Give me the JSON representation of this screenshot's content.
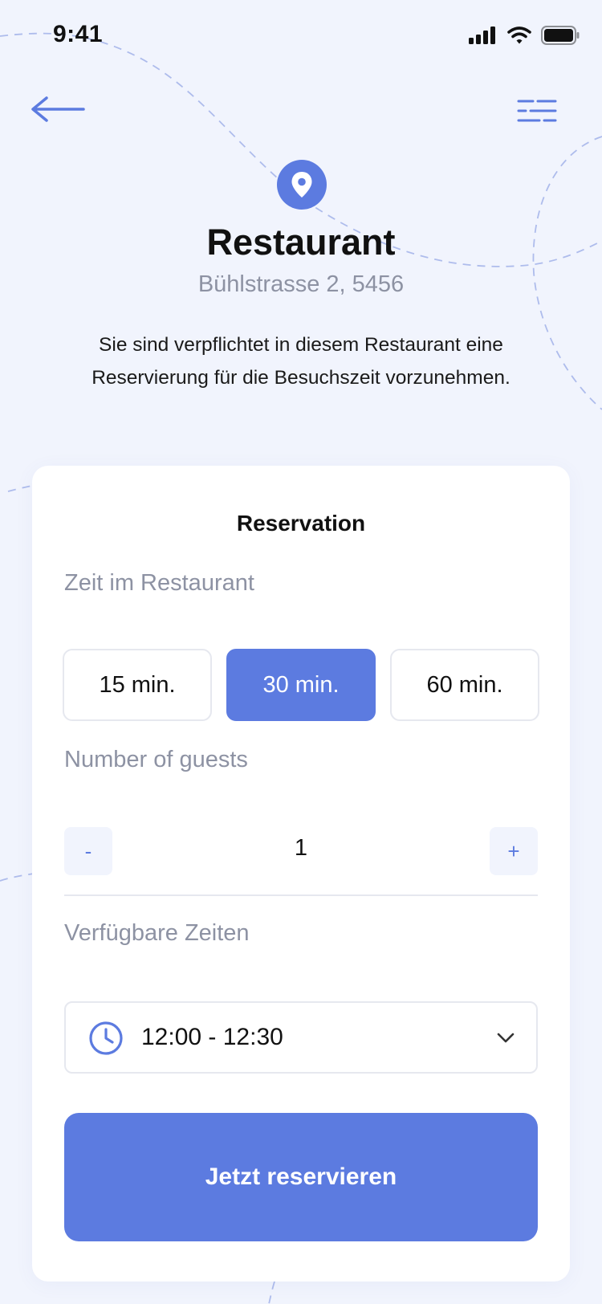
{
  "status_bar": {
    "time": "9:41"
  },
  "header": {
    "back_icon": "arrow-left-icon",
    "menu_icon": "hamburger-menu-icon"
  },
  "place": {
    "icon": "map-pin-icon",
    "name": "Restaurant",
    "address": "Bühlstrasse 2, 5456",
    "description": "Sie sind verpflichtet in diesem Restaurant eine Reservierung für die Besuchszeit vorzunehmen."
  },
  "reservation": {
    "title": "Reservation",
    "duration": {
      "label": "Zeit im Restaurant",
      "options": [
        "15 min.",
        "30 min.",
        "60 min."
      ],
      "selected": "30 min."
    },
    "guests": {
      "label": "Number of guests",
      "decrement": "-",
      "value": "1",
      "increment": "+"
    },
    "times": {
      "label": "Verfügbare Zeiten",
      "icon": "clock-icon",
      "selected": "12:00 - 12:30"
    },
    "submit_label": "Jetzt reservieren"
  },
  "colors": {
    "accent": "#5c7be0",
    "background": "#f1f4fd",
    "muted_text": "#8d92a3",
    "border": "#e6e8ef"
  }
}
